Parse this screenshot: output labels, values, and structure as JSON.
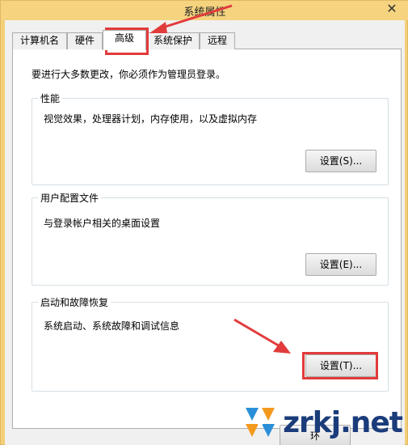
{
  "window": {
    "title": "系统属性",
    "close_label": "✕"
  },
  "tabs": [
    {
      "label": "计算机名"
    },
    {
      "label": "硬件"
    },
    {
      "label": "高级"
    },
    {
      "label": "系统保护"
    },
    {
      "label": "远程"
    }
  ],
  "active_tab": "高级",
  "notice": "要进行大多数更改，你必须作为管理员登录。",
  "groups": {
    "performance": {
      "legend": "性能",
      "description": "视觉效果，处理器计划，内存使用，以及虚拟内存",
      "button": "设置(S)..."
    },
    "user_profiles": {
      "legend": "用户配置文件",
      "description": "与登录帐户相关的桌面设置",
      "button": "设置(E)..."
    },
    "startup_recovery": {
      "legend": "启动和故障恢复",
      "description": "系统启动、系统故障和调试信息",
      "button": "设置(T)..."
    }
  },
  "footer": {
    "partial_button": "环"
  },
  "watermark": {
    "text": "zrkj.net",
    "logo_icon": "watermark-logo-icon"
  },
  "colors": {
    "title_bar": "#f5d37f",
    "annotation": "#e23b3b",
    "watermark": "#1b3c7a"
  }
}
